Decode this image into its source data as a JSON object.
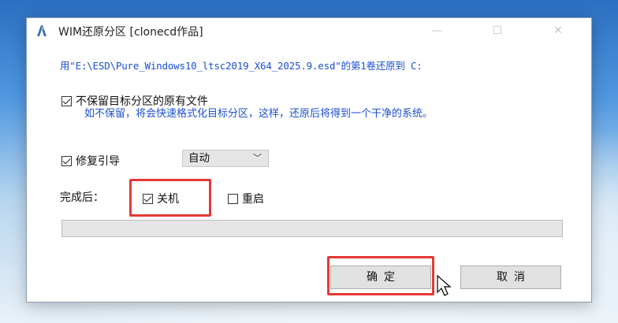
{
  "window": {
    "title": "WIM还原分区  [clonecd作品]",
    "controls": {
      "minimize": "—",
      "maximize": "☐",
      "close": "✕"
    }
  },
  "path_message": "用\"E:\\ESD\\Pure_Windows10_ltsc2019_X64_2025.9.esd\"的第1卷还原到 C:",
  "options": {
    "no_keep_label": "不保留目标分区的原有文件",
    "no_keep_checked": true,
    "no_keep_hint": "如不保留，将会快速格式化目标分区，这样，还原后将得到一个干净的系统。",
    "repair_boot_label": "修复引导",
    "repair_boot_checked": true,
    "repair_boot_mode": "自动"
  },
  "after_done": {
    "label": "完成后：",
    "shutdown_label": "关机",
    "shutdown_checked": true,
    "restart_label": "重启",
    "restart_checked": false
  },
  "progress": {
    "value": 0
  },
  "buttons": {
    "ok": "确定",
    "cancel": "取消"
  },
  "colors": {
    "hint_text": "#1a4fd6",
    "highlight_border": "#e53935",
    "progress_fill": "#06b025"
  },
  "icons": [
    "app-icon",
    "checkbox-checked-icon",
    "checkbox-unchecked-icon",
    "chevron-down-icon",
    "mouse-cursor-icon"
  ]
}
